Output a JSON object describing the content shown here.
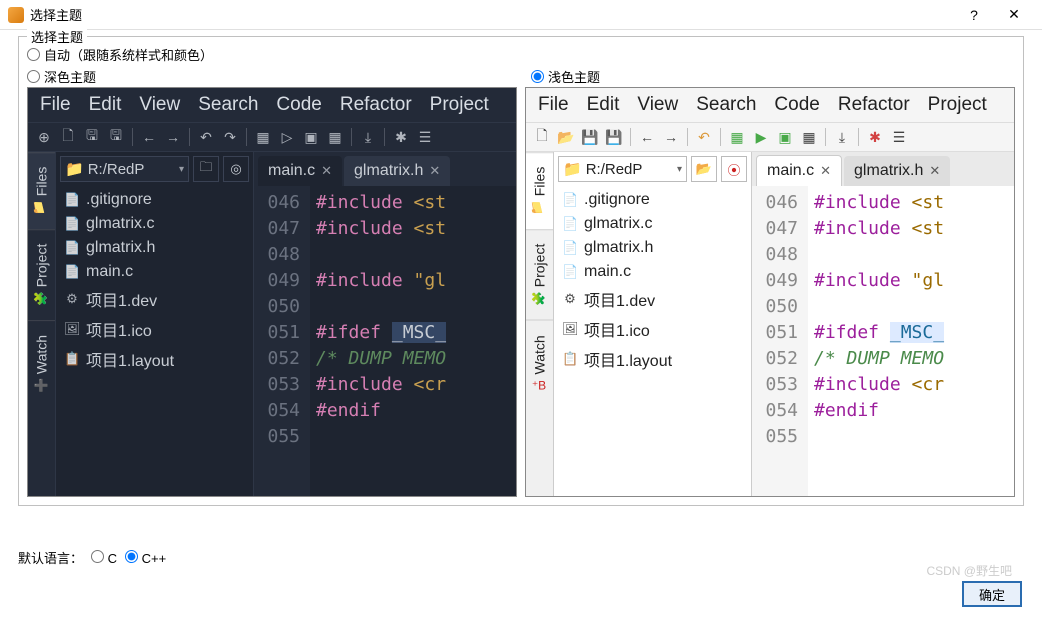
{
  "window": {
    "title": "选择主题"
  },
  "group": {
    "legend": "选择主题"
  },
  "radios": {
    "auto": "自动（跟随系统样式和颜色）",
    "dark": "深色主题",
    "light": "浅色主题"
  },
  "menu": {
    "file": "File",
    "edit": "Edit",
    "view": "View",
    "search": "Search",
    "code": "Code",
    "refactor": "Refactor",
    "project": "Project"
  },
  "side": {
    "files": "Files",
    "project": "Project",
    "watch": "Watch"
  },
  "path": "R:/RedP",
  "files": [
    {
      "icon": "📄",
      "name": ".gitignore"
    },
    {
      "icon": "📄",
      "name": "glmatrix.c"
    },
    {
      "icon": "📄",
      "name": "glmatrix.h"
    },
    {
      "icon": "📄",
      "name": "main.c"
    },
    {
      "icon": "⚙",
      "name": "项目1.dev"
    },
    {
      "icon": "🖼",
      "name": "项目1.ico"
    },
    {
      "icon": "📋",
      "name": "项目1.layout"
    }
  ],
  "tabs": {
    "main": "main.c",
    "gl": "glmatrix.h"
  },
  "lines": [
    "046",
    "047",
    "048",
    "049",
    "050",
    "051",
    "052",
    "053",
    "054",
    "055"
  ],
  "lang": {
    "label": "默认语言：",
    "c": "C",
    "cpp": "C++"
  },
  "ok": "确定",
  "watermark": "CSDN @野生吧"
}
